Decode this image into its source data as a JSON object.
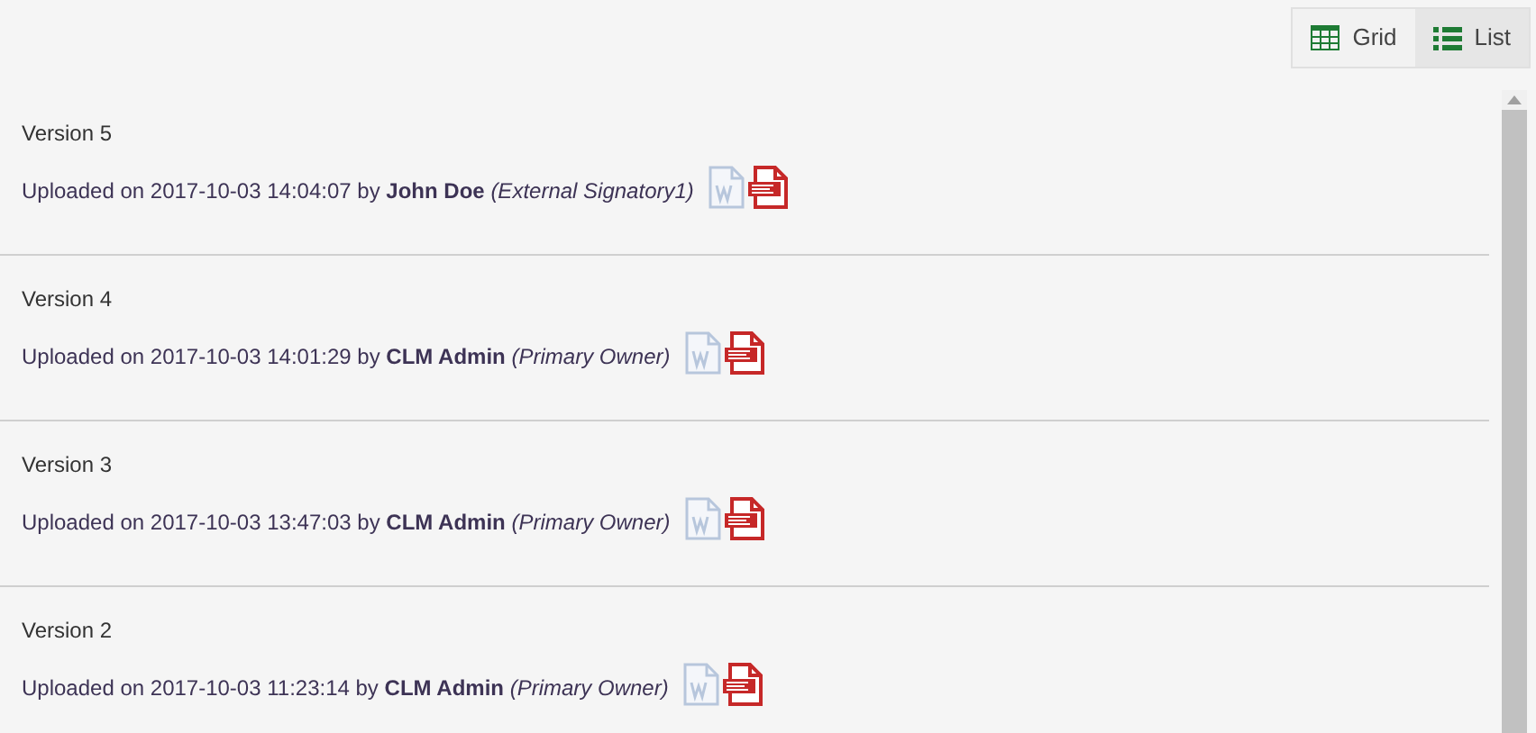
{
  "view_toggle": [
    {
      "label": "Grid",
      "kind": "grid",
      "selected": false
    },
    {
      "label": "List",
      "kind": "list",
      "selected": true
    }
  ],
  "versions": [
    {
      "title": "Version 5",
      "uploaded": "Uploaded on 2017-10-03 14:04:07 by **John Doe** *(External Signatory1)*"
    },
    {
      "title": "Version 4",
      "uploaded": "Uploaded on 2017-10-03 14:01:29 by **CLM Admin** *(Primary Owner)*"
    },
    {
      "title": "Version 3",
      "uploaded": "Uploaded on 2017-10-03 13:47:03 by **CLM Admin** *(Primary Owner)*"
    },
    {
      "title": "Version 2",
      "uploaded": "Uploaded on 2017-10-03 11:23:14 by **CLM Admin** *(Primary Owner)*"
    }
  ]
}
